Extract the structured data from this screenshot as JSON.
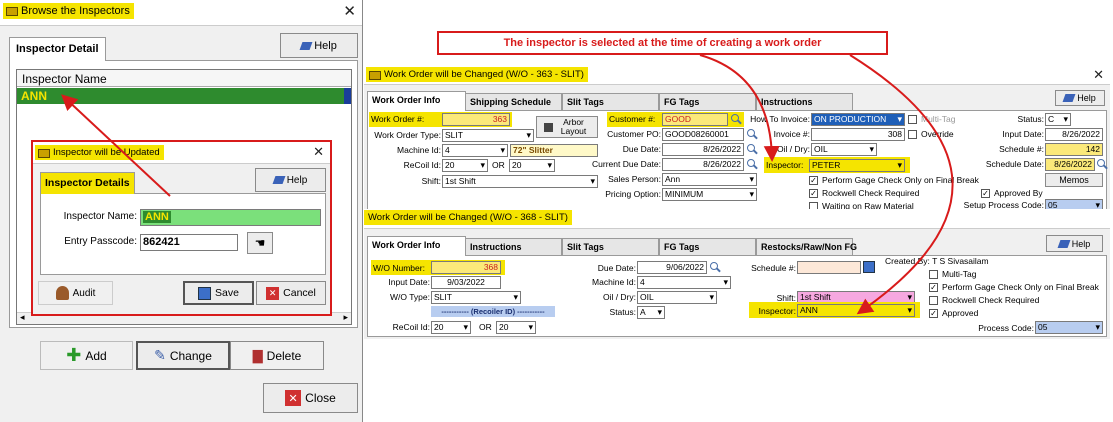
{
  "browse": {
    "title": "Browse the Inspectors",
    "tab": "Inspector Detail",
    "help": "Help",
    "column": "Inspector Name",
    "row": "ANN",
    "add": "Add",
    "change": "Change",
    "delete": "Delete",
    "close": "Close"
  },
  "update": {
    "title": "Inspector will be Updated",
    "tab": "Inspector Details",
    "help": "Help",
    "name_label": "Inspector Name:",
    "name_value": "ANN",
    "passcode_label": "Entry Passcode:",
    "passcode_value": "862421",
    "audit": "Audit",
    "save": "Save",
    "cancel": "Cancel"
  },
  "callout": "The inspector is selected at the time of creating a work order",
  "wo1": {
    "title": "Work Order will be Changed  (W/O - 363 - SLIT)",
    "tabs": [
      "Work Order Info",
      "Shipping Schedule",
      "Slit Tags",
      "FG Tags",
      "Instructions"
    ],
    "help": "Help",
    "wo_label": "Work Order #:",
    "wo_value": "363",
    "type_label": "Work Order Type:",
    "type_value": "SLIT",
    "machine_label": "Machine Id:",
    "machine_value": "4",
    "machine_desc": "72\" Slitter",
    "recoil_label": "ReCoil Id:",
    "recoil1": "20",
    "or": "OR",
    "recoil2": "20",
    "shift_label": "Shift:",
    "shift_value": "1st Shift",
    "arbor": "Arbor Layout",
    "customer_label": "Customer #:",
    "customer_value": "GOOD",
    "po_label": "Customer PO:",
    "po_value": "GOOD08260001",
    "due_label": "Due Date:",
    "due_value": "8/26/2022",
    "curdue_label": "Current Due Date:",
    "curdue_value": "8/26/2022",
    "sales_label": "Sales Person:",
    "sales_value": "Ann",
    "pricing_label": "Pricing Option:",
    "pricing_value": "MINIMUM",
    "howinv_label": "How To Invoice:",
    "howinv_value": "ON PRODUCTION",
    "inv_label": "Invoice #:",
    "inv_value": "308",
    "oil_label": "Oil / Dry:",
    "oil_value": "OIL",
    "inspector_label": "Inspector:",
    "inspector_value": "PETER",
    "gage": "Perform Gage Check Only on Final Break",
    "rockwell": "Rockwell Check Required",
    "waiting": "Waiting on Raw Material",
    "multitag": "Multi-Tag",
    "override": "Override",
    "approved": "Approved By",
    "status_label": "Status:",
    "status_value": "C",
    "input_label": "Input Date:",
    "input_value": "8/26/2022",
    "sched_label": "Schedule #:",
    "sched_value": "142",
    "scheddate_label": "Schedule Date:",
    "scheddate_value": "8/26/2022",
    "memos": "Memos",
    "setup_label": "Setup Process Code:",
    "setup_value": "05"
  },
  "wo2": {
    "title": "Work Order will be Changed  (W/O - 368 - SLIT)",
    "tabs": [
      "Work Order Info",
      "Instructions",
      "Slit Tags",
      "FG Tags",
      "Restocks/Raw/Non FG"
    ],
    "help": "Help",
    "wo_label": "W/O Number:",
    "wo_value": "368",
    "input_label": "Input Date:",
    "input_value": "9/03/2022",
    "type_label": "W/O Type:",
    "type_value": "SLIT",
    "recoiler": "----------- (Recoiler ID) -----------",
    "recoil_label": "ReCoil Id:",
    "recoil1": "20",
    "or": "OR",
    "recoil2": "20",
    "due_label": "Due Date:",
    "due_value": "9/06/2022",
    "machine_label": "Machine Id:",
    "machine_value": "4",
    "oil_label": "Oil / Dry:",
    "oil_value": "OIL",
    "status_label": "Status:",
    "status_value": "A",
    "sched_label": "Schedule #:",
    "created": "Created By: T S Sivasailam",
    "shift_label": "Shift:",
    "shift_value": "1st Shift",
    "inspector_label": "Inspector:",
    "inspector_value": "ANN",
    "multitag": "Multi-Tag",
    "gage": "Perform Gage Check Only on Final Break",
    "rockwell": "Rockwell Check Required",
    "approved": "Approved",
    "process_label": "Process Code:",
    "process_value": "05"
  }
}
